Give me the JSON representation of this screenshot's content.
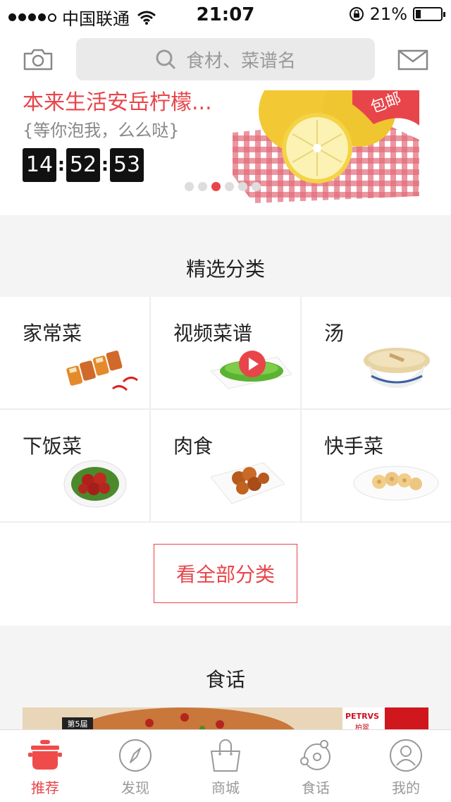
{
  "status": {
    "carrier": "中国联通",
    "time": "21:07",
    "battery": "21%",
    "battery_level": 0.21
  },
  "header": {
    "search_placeholder": "食材、菜谱名"
  },
  "banner": {
    "title": "本来生活安岳柠檬...",
    "subtitle": "{等你泡我，么么哒}",
    "countdown": {
      "h": "14",
      "m": "52",
      "s": "53"
    },
    "tag": "包邮",
    "pages": 6,
    "active_page": 3
  },
  "categories": {
    "title": "精选分类",
    "items": [
      {
        "label": "家常菜"
      },
      {
        "label": "视频菜谱"
      },
      {
        "label": "汤"
      },
      {
        "label": "下饭菜"
      },
      {
        "label": "肉食"
      },
      {
        "label": "快手菜"
      }
    ],
    "view_all": "看全部分类"
  },
  "talk": {
    "title": "食话",
    "badge": "第5届",
    "brand1": "PETRVS",
    "brand1_sub": "柏翠"
  },
  "tabs": [
    {
      "label": "推荐",
      "icon": "pot-icon"
    },
    {
      "label": "发现",
      "icon": "compass-icon"
    },
    {
      "label": "商城",
      "icon": "shopping-bag-icon"
    },
    {
      "label": "食话",
      "icon": "orbit-icon"
    },
    {
      "label": "我的",
      "icon": "user-icon"
    }
  ],
  "colors": {
    "accent": "#e8454a"
  }
}
